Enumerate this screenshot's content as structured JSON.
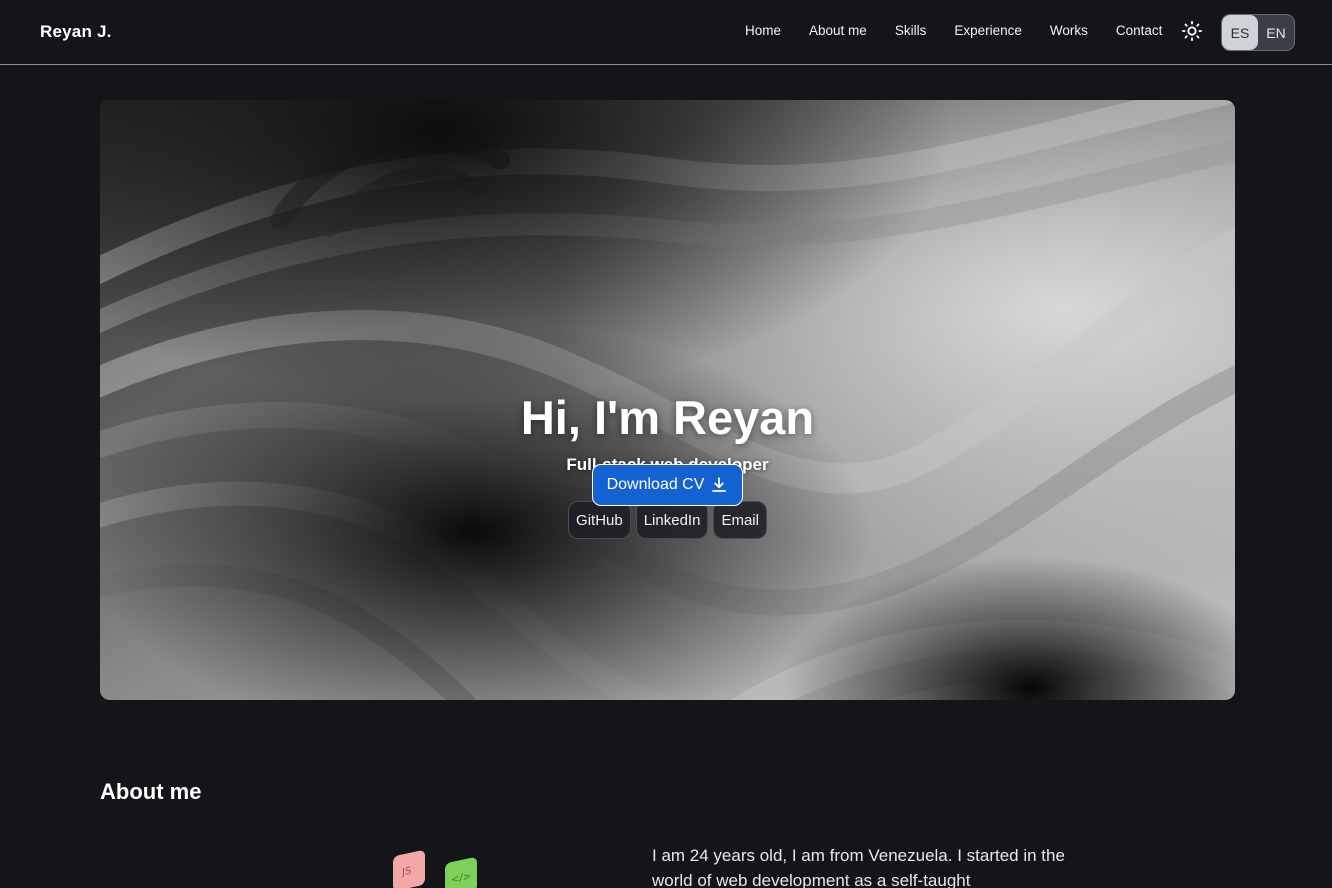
{
  "header": {
    "brand": "Reyan J.",
    "nav": [
      "Home",
      "About me",
      "Skills",
      "Experience",
      "Works",
      "Contact"
    ],
    "theme_icon": "sun-icon",
    "languages": [
      {
        "label": "ES",
        "active": true
      },
      {
        "label": "EN",
        "active": false
      }
    ]
  },
  "hero": {
    "title": "Hi, I'm Reyan",
    "subtitle": "Full-stack web developer",
    "socials": [
      "GitHub",
      "LinkedIn",
      "Email"
    ],
    "cv_button": "Download CV",
    "cv_icon": "download-icon"
  },
  "about": {
    "title": "About me",
    "text": "I am 24 years old, I am from Venezuela. I started in the world of web development as a self-taught",
    "badges": [
      "JS",
      "</>"
    ]
  },
  "colors": {
    "background": "#131519",
    "accent": "#1462d2"
  }
}
